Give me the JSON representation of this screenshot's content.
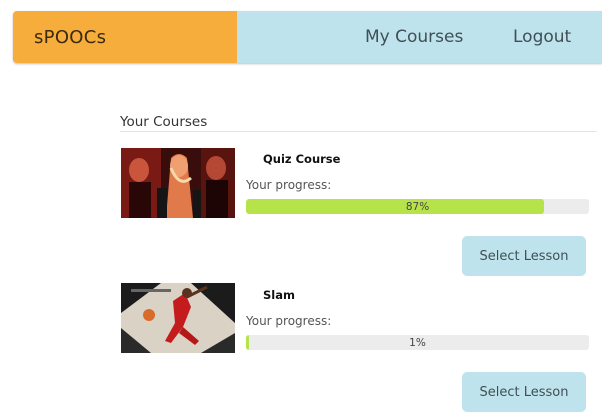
{
  "header": {
    "brand": "sPOOCs",
    "nav": [
      {
        "label": "My Courses"
      },
      {
        "label": "Logout"
      }
    ]
  },
  "main": {
    "section_title": "Your Courses",
    "courses": [
      {
        "title": "Quiz Course",
        "progress_label": "Your progress:",
        "progress_percent": 87,
        "progress_text": "87%",
        "button_label": "Select Lesson"
      },
      {
        "title": "Slam",
        "progress_label": "Your progress:",
        "progress_percent": 1,
        "progress_text": "1%",
        "button_label": "Select Lesson"
      }
    ]
  },
  "colors": {
    "brand_bg": "#f7ad3c",
    "nav_bg": "#bfe3ec",
    "progress_fill": "#b7e34a",
    "progress_track": "#ececec",
    "button_bg": "#bfe3ec"
  }
}
